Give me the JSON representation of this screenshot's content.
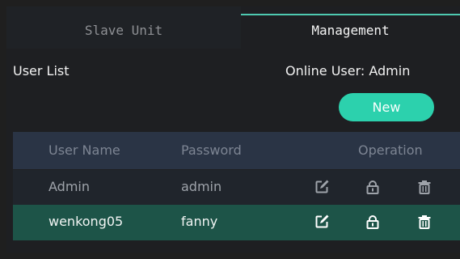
{
  "tabs": [
    {
      "label": "Slave Unit",
      "active": false
    },
    {
      "label": "Management",
      "active": true
    }
  ],
  "user_list_title": "User List",
  "online_user_label": "Online User: Admin",
  "new_button_label": "New",
  "table": {
    "headers": {
      "name": "User Name",
      "password": "Password",
      "operation": "Operation"
    },
    "rows": [
      {
        "name": "Admin",
        "password": "admin",
        "selected": false
      },
      {
        "name": "wenkong05",
        "password": "fanny",
        "selected": true
      }
    ]
  },
  "icons": {
    "edit": "edit-icon",
    "lock": "lock-icon",
    "delete": "trash-icon"
  },
  "colors": {
    "accent": "#2cd1ad",
    "tab_underline": "#4ec9b0",
    "header_bg": "#2a3445",
    "selected_row_bg": "#1d5448",
    "background": "#1e1f22"
  }
}
